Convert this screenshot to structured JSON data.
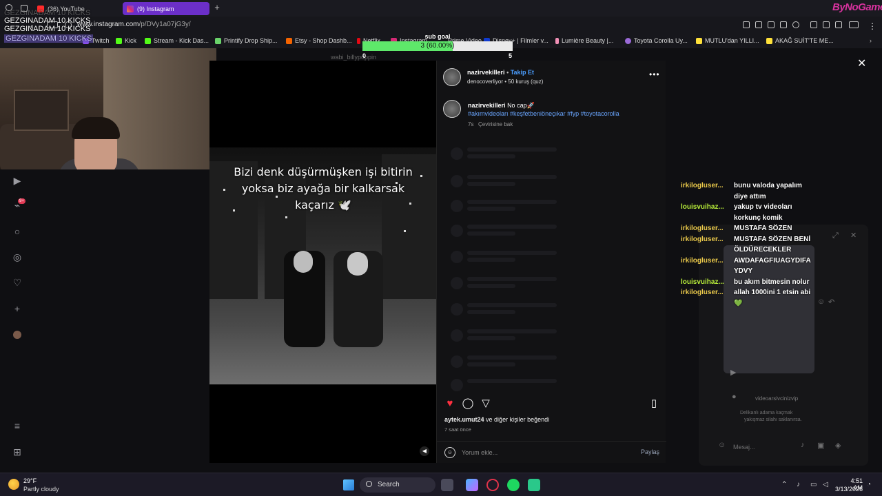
{
  "browser": {
    "tabs": [
      {
        "label": "(36) YouTube"
      },
      {
        "label": "(9) Instagram"
      }
    ],
    "url_prefix": "www.instagram.com",
    "url_path": "/p/DVy1a07jG3y/",
    "brand_logo": "ByNoGame",
    "bookmarks": [
      {
        "label": "Twitch",
        "color": "#8a4cf0"
      },
      {
        "label": "Kick",
        "color": "#53fc18"
      },
      {
        "label": "Stream - Kick Das...",
        "color": "#53fc18"
      },
      {
        "label": "Printify Drop Ship...",
        "color": "#6ad36a"
      },
      {
        "label": "Etsy - Shop Dashb...",
        "color": "#f56400"
      },
      {
        "label": "Netflix",
        "color": "#e50914"
      },
      {
        "label": "Instagram",
        "color": "#d62976"
      },
      {
        "label": "Prime Video",
        "color": "#1ea7e8"
      },
      {
        "label": "Disney+ | Filmler v...",
        "color": "#113ccf"
      },
      {
        "label": "Lumière Beauty |...",
        "color": "#f08fb5"
      },
      {
        "label": "Toyota Corolla Uy...",
        "color": "#9b6ad8"
      },
      {
        "label": "MUTLU'dan YILLI...",
        "color": "#ffe13a"
      },
      {
        "label": "AKAĞ SUİT'TE ME...",
        "color": "#ffe13a"
      }
    ]
  },
  "stream_overlay": {
    "kicks_lines": [
      "GEZGINADAM 10 KICKS",
      "GEZGINADAM 10 KICKS",
      "GEZGINADAM 10 KICKS",
      "GEZGINADAM 10 KICKS"
    ],
    "sub_goal": {
      "title": "sub goal",
      "progress_text": "3 (60.00%)",
      "progress_fraction": 0.6,
      "min": "0",
      "max": "5"
    }
  },
  "post": {
    "ghost_username": "wabi_billypoppin",
    "header": {
      "username": "nazirvekilleri",
      "follow_label": "Takip Et",
      "subtext": "denocoverliyor • 50 kuruş (quz)"
    },
    "image_caption": "Bizi denk düşürmüşken işi bitirin yoksa biz ayağa bir kalkarsak kaçarız 🕊️",
    "caption": {
      "username": "nazirvekilleri",
      "text": "No cap🚀",
      "hashtags": "#akımvideoları #keşfetbeniöneçıkar #fyp #toyotacorolla",
      "time": "7s",
      "translate_label": "Çevirisine bak"
    },
    "likes": {
      "user": "aytek.umut24",
      "text": "ve diğer kişiler beğendi",
      "time": "7 saat önce"
    },
    "comment_placeholder": "Yorum ekle...",
    "share_label": "Paylaş",
    "liked_color": "#ff3040"
  },
  "chat": {
    "messages": [
      {
        "user": "irkilogluser...",
        "text": "bunu valoda yapalım diye attım",
        "user_color": "gold"
      },
      {
        "user": "louisvuihaz...",
        "text": "yakup tv videoları korkunç komik",
        "user_color": "green"
      },
      {
        "user": "irkilogluser...",
        "text": "MUSTAFA SÖZEN",
        "user_color": "gold"
      },
      {
        "user": "irkilogluser...",
        "text": "MUSTAFA SÖZEN BENİ ÖLDÜRECEKLER",
        "user_color": "gold"
      },
      {
        "user": "irkilogluser...",
        "text": "AWDAFAGFIUAGYDIFA YDVY",
        "user_color": "gold"
      },
      {
        "user": "louisvuihaz...",
        "text": "bu akım bitmesin nolur",
        "user_color": "green"
      },
      {
        "user": "irkilogluser...",
        "text": "allah 1000ini 1 etsin abi 💚",
        "user_color": "gold"
      }
    ]
  },
  "ghost_dm": {
    "username": "videoarsivcinizvip",
    "line1": "Delikanlı adama kaçmak",
    "line2": "yakışmaz silahı saklanırsa.",
    "message_placeholder": "Mesaj..."
  },
  "taskbar": {
    "temperature": "29°F",
    "weather": "Partly cloudy",
    "search_label": "Search",
    "time": "4:51 AM",
    "date": "3/13/2026"
  }
}
